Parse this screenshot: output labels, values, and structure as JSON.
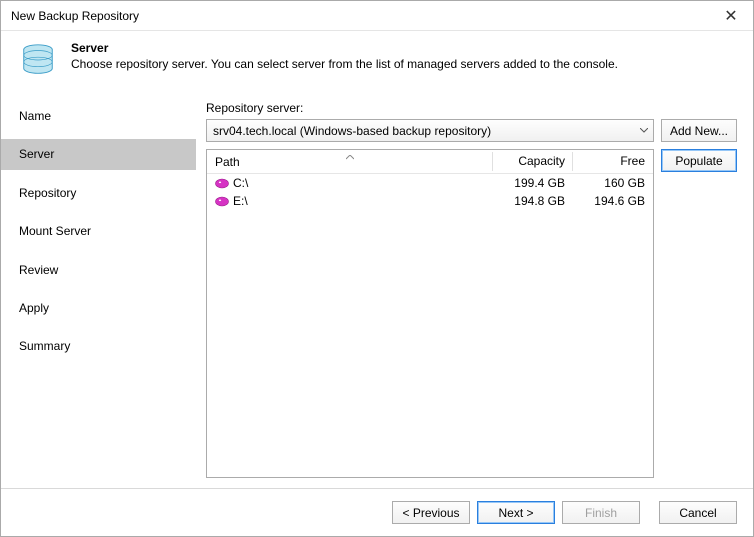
{
  "window": {
    "title": "New Backup Repository"
  },
  "header": {
    "title": "Server",
    "description": "Choose repository server. You can select server from the list of managed servers added to the console."
  },
  "sidebar": {
    "items": [
      {
        "label": "Name",
        "selected": false
      },
      {
        "label": "Server",
        "selected": true
      },
      {
        "label": "Repository",
        "selected": false
      },
      {
        "label": "Mount Server",
        "selected": false
      },
      {
        "label": "Review",
        "selected": false
      },
      {
        "label": "Apply",
        "selected": false
      },
      {
        "label": "Summary",
        "selected": false
      }
    ]
  },
  "main": {
    "repo_server_label": "Repository server:",
    "combo_value": "srv04.tech.local (Windows-based backup repository)",
    "add_new_label": "Add New...",
    "populate_label": "Populate",
    "columns": {
      "path": "Path",
      "capacity": "Capacity",
      "free": "Free"
    },
    "rows": [
      {
        "path": "C:\\",
        "capacity": "199.4 GB",
        "free": "160 GB"
      },
      {
        "path": "E:\\",
        "capacity": "194.8 GB",
        "free": "194.6 GB"
      }
    ]
  },
  "footer": {
    "previous": "< Previous",
    "next": "Next >",
    "finish": "Finish",
    "cancel": "Cancel"
  }
}
